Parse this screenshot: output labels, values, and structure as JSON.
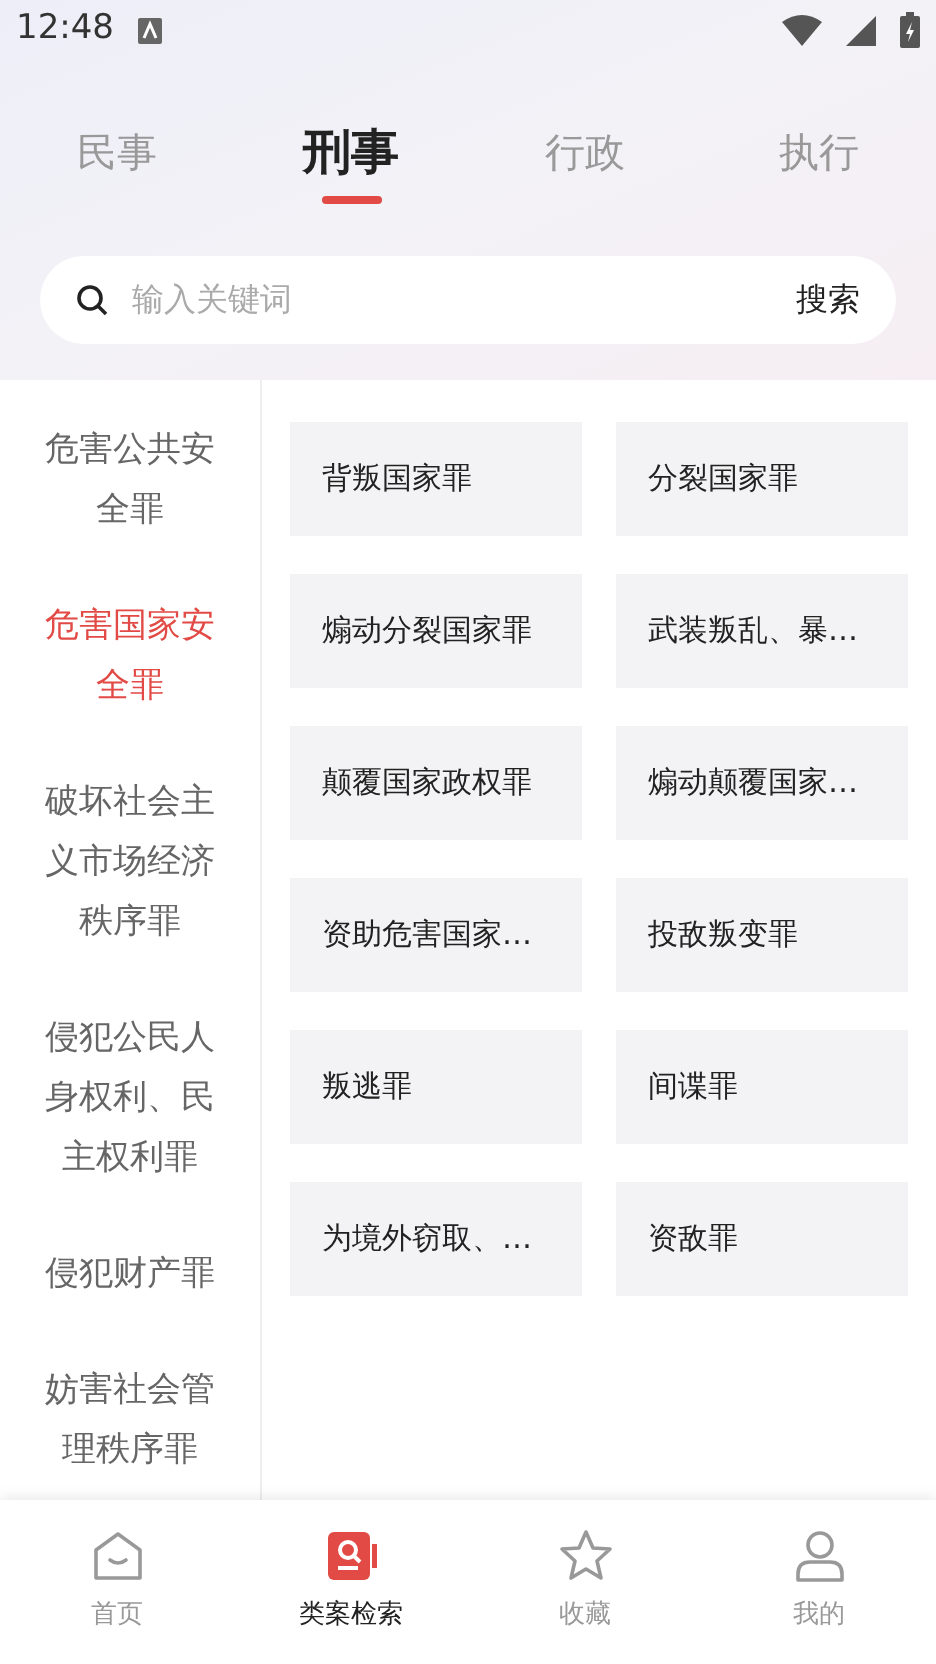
{
  "status_bar": {
    "time": "12:48"
  },
  "tabs": [
    {
      "label": "民事",
      "selected": false
    },
    {
      "label": "刑事",
      "selected": true
    },
    {
      "label": "行政",
      "selected": false
    },
    {
      "label": "执行",
      "selected": false
    }
  ],
  "search": {
    "placeholder": "输入关键词",
    "button": "搜索"
  },
  "categories": [
    {
      "label": "危害公共安全罪",
      "selected": false
    },
    {
      "label": "危害国家安全罪",
      "selected": true
    },
    {
      "label": "破坏社会主义市场经济秩序罪",
      "selected": false
    },
    {
      "label": "侵犯公民人身权利、民主权利罪",
      "selected": false
    },
    {
      "label": "侵犯财产罪",
      "selected": false
    },
    {
      "label": "妨害社会管理秩序罪",
      "selected": false
    }
  ],
  "charges": [
    "背叛国家罪",
    "分裂国家罪",
    "煽动分裂国家罪",
    "武装叛乱、暴…",
    "颠覆国家政权罪",
    "煽动颠覆国家…",
    "资助危害国家…",
    "投敌叛变罪",
    "叛逃罪",
    "间谍罪",
    "为境外窃取、…",
    "资敌罪"
  ],
  "bottom_nav": [
    {
      "kind": "home",
      "label": "首页",
      "selected": false
    },
    {
      "kind": "cases",
      "label": "类案检索",
      "selected": true
    },
    {
      "kind": "favorites",
      "label": "收藏",
      "selected": false
    },
    {
      "kind": "profile",
      "label": "我的",
      "selected": false
    }
  ]
}
